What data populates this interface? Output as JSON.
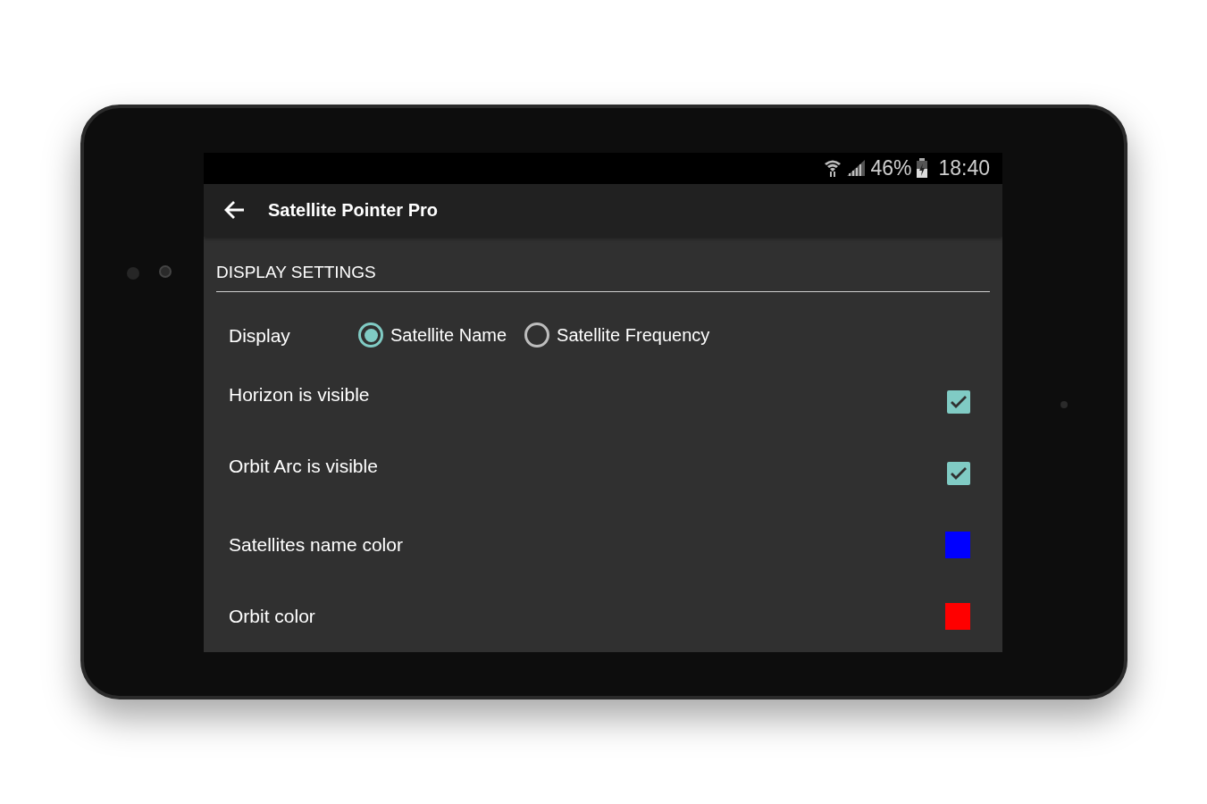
{
  "status_bar": {
    "battery": "46%",
    "time": "18:40"
  },
  "app_bar": {
    "title": "Satellite Pointer Pro"
  },
  "section": {
    "title": "DISPLAY SETTINGS"
  },
  "display": {
    "label": "Display",
    "options": [
      {
        "label": "Satellite Name",
        "selected": true
      },
      {
        "label": "Satellite Frequency",
        "selected": false
      }
    ]
  },
  "settings": [
    {
      "kind": "checkbox",
      "label": "Horizon is visible",
      "checked": true
    },
    {
      "kind": "checkbox",
      "label": "Orbit Arc is visible",
      "checked": true
    },
    {
      "kind": "color",
      "label": "Satellites name color",
      "color": "#0000ff"
    },
    {
      "kind": "color",
      "label": "Orbit color",
      "color": "#ff0000"
    }
  ]
}
